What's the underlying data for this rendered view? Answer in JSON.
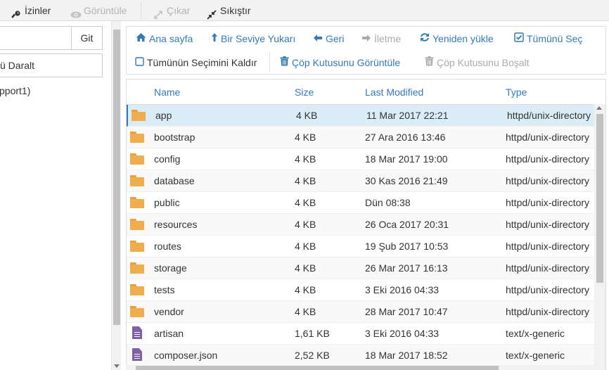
{
  "toolbar": {
    "permissions": "İzinler",
    "view": "Görüntüle",
    "extract": "Çıkar",
    "compress": "Sıkıştır"
  },
  "left_panel": {
    "go_button": "Git",
    "go_input_value": "",
    "collapse_label": "ü Daralt",
    "tree_root": "pport1)"
  },
  "actions": {
    "home": "Ana sayfa",
    "up_one_level": "Bir Seviye Yukarı",
    "back": "Geri",
    "forward": "İletme",
    "reload": "Yeniden yükle",
    "select_all": "Tümünü Seç",
    "deselect_all": "Tümünün Seçimini Kaldır",
    "view_trash": "Çöp Kutusunu Görüntüle",
    "empty_trash": "Çöp Kutusunu Boşalt"
  },
  "table": {
    "columns": [
      "Name",
      "Size",
      "Last Modified",
      "Type"
    ],
    "rows": [
      {
        "icon": "folder-icon",
        "name": "app",
        "size": "4 KB",
        "modified": "11 Mar 2017 22:21",
        "type": "httpd/unix-directory"
      },
      {
        "icon": "folder-icon",
        "name": "bootstrap",
        "size": "4 KB",
        "modified": "27 Ara 2016 13:46",
        "type": "httpd/unix-directory"
      },
      {
        "icon": "folder-icon",
        "name": "config",
        "size": "4 KB",
        "modified": "18 Mar 2017 19:00",
        "type": "httpd/unix-directory"
      },
      {
        "icon": "folder-icon",
        "name": "database",
        "size": "4 KB",
        "modified": "30 Kas 2016 21:49",
        "type": "httpd/unix-directory"
      },
      {
        "icon": "folder-icon",
        "name": "public",
        "size": "4 KB",
        "modified": "Dün 08:38",
        "type": "httpd/unix-directory"
      },
      {
        "icon": "folder-icon",
        "name": "resources",
        "size": "4 KB",
        "modified": "26 Oca 2017 20:31",
        "type": "httpd/unix-directory"
      },
      {
        "icon": "folder-icon",
        "name": "routes",
        "size": "4 KB",
        "modified": "19 Şub 2017 10:53",
        "type": "httpd/unix-directory"
      },
      {
        "icon": "folder-icon",
        "name": "storage",
        "size": "4 KB",
        "modified": "26 Mar 2017 16:13",
        "type": "httpd/unix-directory"
      },
      {
        "icon": "folder-icon",
        "name": "tests",
        "size": "4 KB",
        "modified": "3 Eki 2016 04:33",
        "type": "httpd/unix-directory"
      },
      {
        "icon": "folder-icon",
        "name": "vendor",
        "size": "4 KB",
        "modified": "28 Mar 2017 10:47",
        "type": "httpd/unix-directory"
      },
      {
        "icon": "file-icon",
        "name": "artisan",
        "size": "1,61 KB",
        "modified": "3 Eki 2016 04:33",
        "type": "text/x-generic"
      },
      {
        "icon": "file-icon",
        "name": "composer.json",
        "size": "2,52 KB",
        "modified": "18 Mar 2017 18:52",
        "type": "text/x-generic"
      }
    ],
    "selected_row": "app"
  },
  "colors": {
    "link_blue": "#337ab7",
    "folder_orange": "#f0ad4e",
    "file_purple": "#7f5fa6",
    "selected_row_bg": "#d9edf7"
  }
}
